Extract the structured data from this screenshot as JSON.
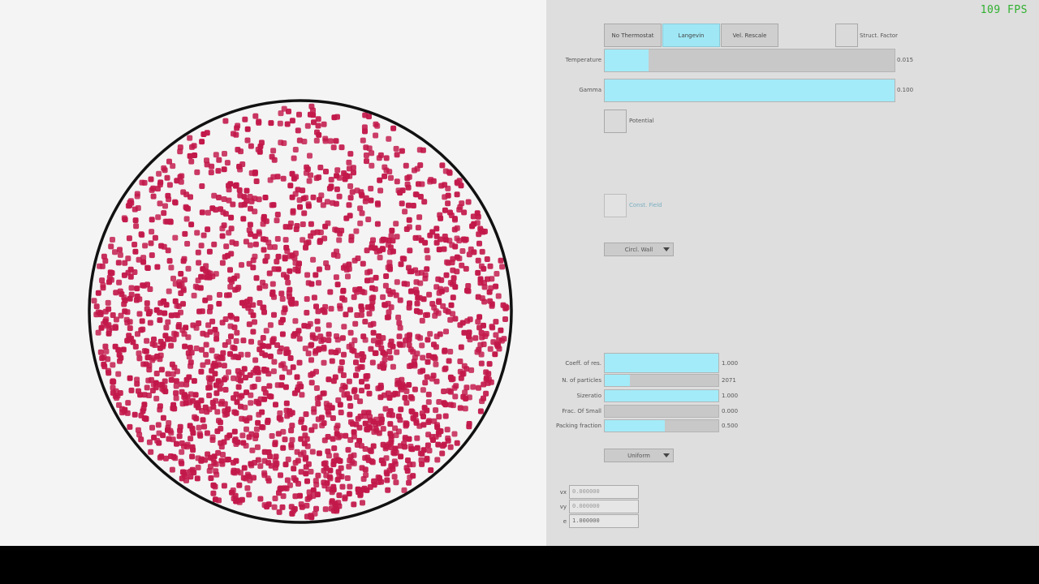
{
  "fps": "109 FPS",
  "thermostat": {
    "options": [
      "No Thermostat",
      "Langevin",
      "Vel. Rescale"
    ],
    "active": "Langevin"
  },
  "struct_factor": {
    "label": "Struct. Factor",
    "checked": false
  },
  "temperature": {
    "label": "Temperature",
    "value_text": "0.015",
    "fraction": 0.15
  },
  "gamma": {
    "label": "Gamma",
    "value_text": "0.100",
    "fraction": 1.0
  },
  "potential": {
    "label": "Potential",
    "checked": false
  },
  "const_field": {
    "label": "Const. Field",
    "checked": false
  },
  "wall_select": {
    "value": "Circl. Wall"
  },
  "params": {
    "coeff_res": {
      "label": "Coeff. of res.",
      "value_text": "1.000",
      "fraction": 1.0
    },
    "n_particles": {
      "label": "N. of particles",
      "value_text": "2071",
      "fraction": 0.22
    },
    "sizeratio": {
      "label": "Sizeratio",
      "value_text": "1.000",
      "fraction": 1.0
    },
    "frac_small": {
      "label": "Frac. Of Small",
      "value_text": "0.000",
      "fraction": 0.0
    },
    "packing_fraction": {
      "label": "Packing fraction",
      "value_text": "0.500",
      "fraction": 0.53
    }
  },
  "distribution_select": {
    "value": "Uniform"
  },
  "fields": {
    "vx": {
      "label": "vx",
      "value": "0.000000"
    },
    "vy": {
      "label": "vy",
      "value": "0.000000"
    },
    "e": {
      "label": "e",
      "value": "1.000000"
    }
  },
  "colors": {
    "particle": "#c2184a",
    "slider_fill": "#a3ebf8",
    "fps": "#2fb02f"
  }
}
